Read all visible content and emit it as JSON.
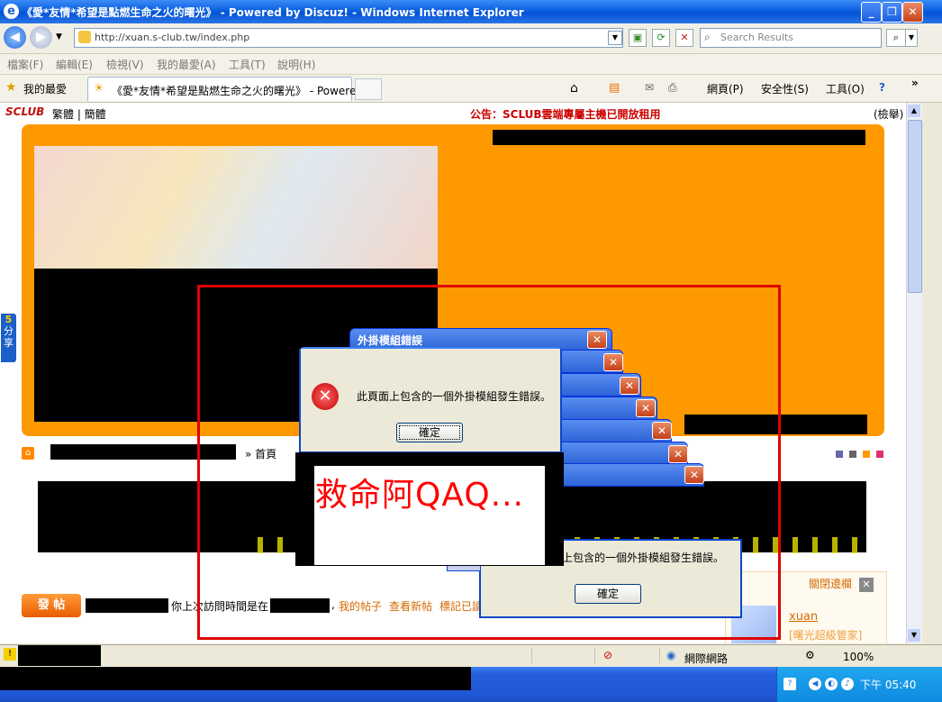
{
  "window": {
    "title": "《愛*友情*希望是點燃生命之火的曙光》 - Powered by Discuz! - Windows Internet Explorer",
    "min_glyph": "_",
    "max_glyph": "❐",
    "close_glyph": "✕"
  },
  "address": {
    "url": "http://xuan.s-club.tw/index.php",
    "search_placeholder": "Search Results"
  },
  "menu": [
    "檔案(F)",
    "編輯(E)",
    "檢視(V)",
    "我的最愛(A)",
    "工具(T)",
    "說明(H)"
  ],
  "favorites": {
    "label": "我的最愛",
    "tab_title": "《愛*友情*希望是點燃生命之火的曙光》 - Powere...",
    "page_menu": "網頁(P)",
    "safety_menu": "安全性(S)",
    "tools_menu": "工具(O)",
    "more": "»"
  },
  "site": {
    "logo": "SCLUB",
    "lang_links": "繁體 | 簡體",
    "announcement": "公告：SCLUB雲端專屬主機已開放租用",
    "report": "(檢舉)",
    "breadcrumb_home": "» 首頁",
    "post_button": "發 帖",
    "visit_text_a": "你上次訪問時間是在",
    "link_my_posts": "我的帖子",
    "link_new_posts": "查看新帖",
    "link_mark": "標記已讀",
    "close_sidebar": "關閉邊欄",
    "username": "xuan",
    "user_role": "[曙光超級管家]",
    "share": "分享"
  },
  "dialog": {
    "title": "外掛模組錯誤",
    "message": "此頁面上包含的一個外掛模組發生錯誤。",
    "message_partial": "上包含的一個外掛模組發生錯誤。",
    "ok": "確定",
    "overlay_text": "救命阿QAQ..."
  },
  "statusbar": {
    "zone": "網際網路",
    "zoom": "100%"
  },
  "taskbar": {
    "clock": "下午 05:40"
  },
  "colors": {
    "orange": "#ff9900",
    "annotation_red": "#e00000",
    "link": "#d46a00"
  }
}
